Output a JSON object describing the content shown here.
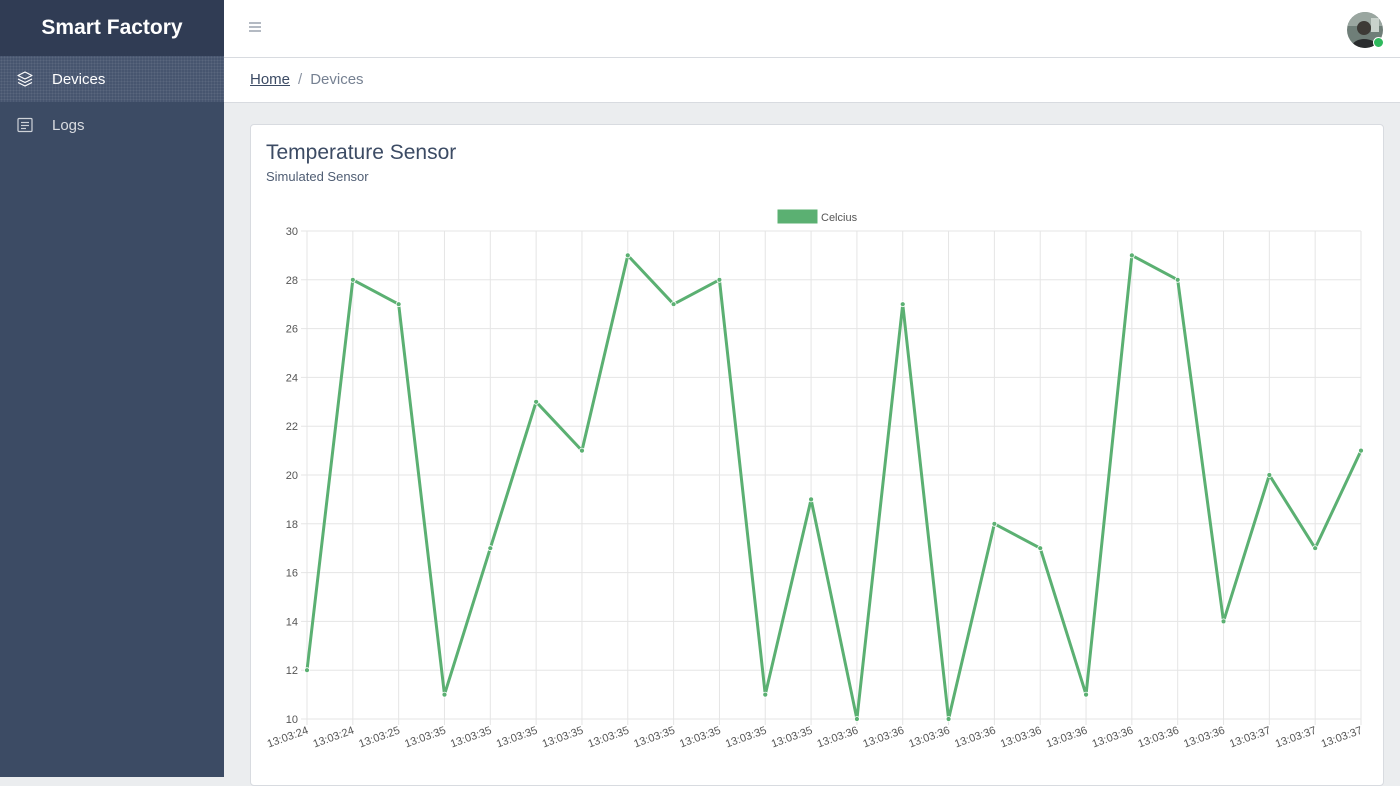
{
  "sidebar": {
    "brand": "Smart Factory",
    "items": [
      {
        "label": "Devices",
        "icon": "layers-icon",
        "active": true
      },
      {
        "label": "Logs",
        "icon": "list-icon",
        "active": false
      }
    ]
  },
  "header": {
    "menu_icon": "hamburger-icon",
    "avatar_status_color": "#2eb85c"
  },
  "breadcrumb": {
    "home": "Home",
    "separator": "/",
    "current": "Devices"
  },
  "card": {
    "title": "Temperature Sensor",
    "subtitle": "Simulated Sensor"
  },
  "chart_data": {
    "type": "line",
    "x": [
      "13:03:24",
      "13:03:24",
      "13:03:25",
      "13:03:35",
      "13:03:35",
      "13:03:35",
      "13:03:35",
      "13:03:35",
      "13:03:35",
      "13:03:35",
      "13:03:35",
      "13:03:35",
      "13:03:36",
      "13:03:36",
      "13:03:36",
      "13:03:36",
      "13:03:36",
      "13:03:36",
      "13:03:36",
      "13:03:36",
      "13:03:36",
      "13:03:37",
      "13:03:37",
      "13:03:37"
    ],
    "series": [
      {
        "name": "Celcius",
        "color": "#5bb072",
        "values": [
          12,
          28,
          27,
          11,
          17,
          23,
          21,
          29,
          27,
          28,
          11,
          19,
          10,
          27,
          10,
          18,
          17,
          11,
          29,
          28,
          14,
          20,
          17,
          21
        ]
      }
    ],
    "ylim": [
      10,
      30
    ],
    "yticks": [
      10,
      12,
      14,
      16,
      18,
      20,
      22,
      24,
      26,
      28,
      30
    ],
    "grid": true,
    "legend_position": "top-center"
  }
}
